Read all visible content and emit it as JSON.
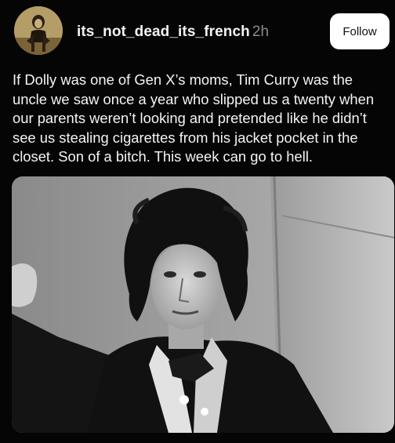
{
  "post": {
    "username": "its_not_dead_its_french",
    "timestamp": "2h",
    "follow_label": "Follow",
    "text": "If Dolly was one of Gen X’s moms, Tim Curry was the\nuncle we saw once a year who slipped us a twenty when\nour parents weren’t looking and pretended like he didn’t\nsee us stealing cigarettes from his jacket pocket in the\ncloset.  Son of a bitch.  This week can go to hell."
  },
  "colors": {
    "background": "#050505",
    "text": "#f4f4f4",
    "timestamp": "#8c8c8c",
    "follow_button_bg": "#ffffff"
  }
}
